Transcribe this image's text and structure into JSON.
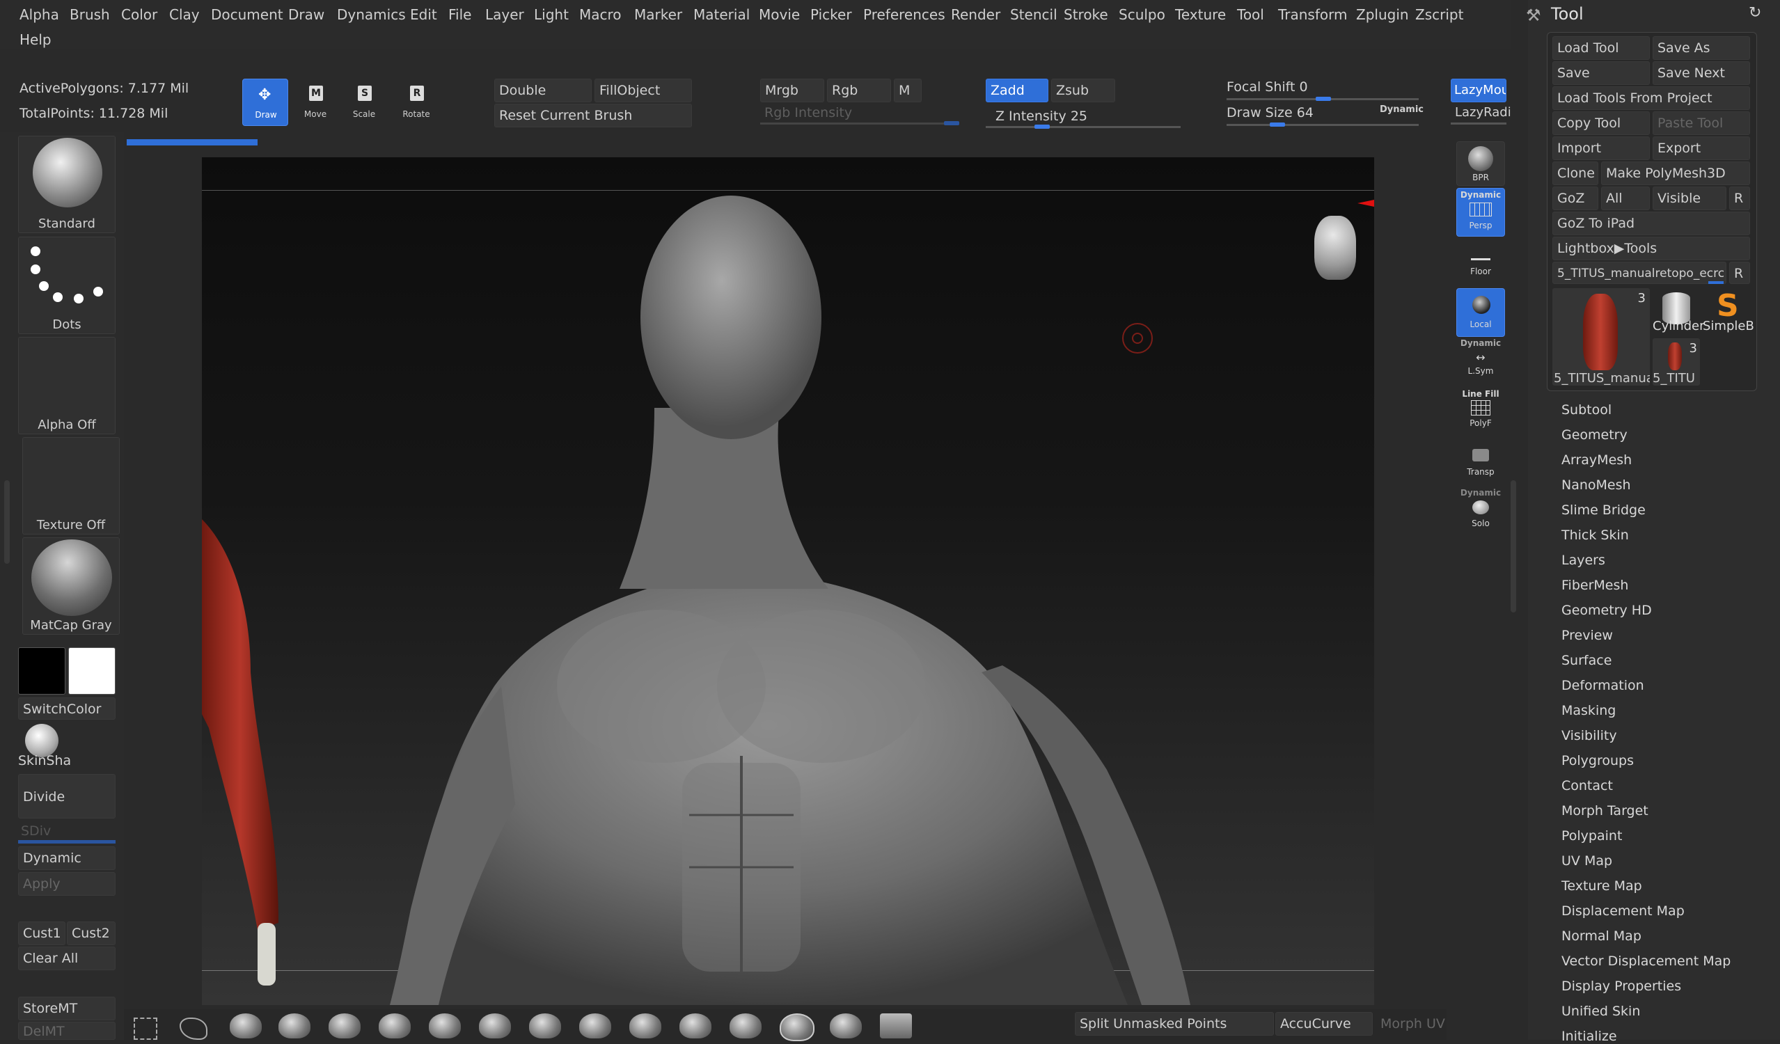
{
  "menu": {
    "row1": [
      "Alpha",
      "Brush",
      "Color",
      "Clay",
      "Document",
      "Draw",
      "Dynamics",
      "Edit",
      "File",
      "Layer",
      "Light",
      "Macro",
      "Marker",
      "Material",
      "Movie",
      "Picker",
      "Preferences",
      "Render",
      "Stencil",
      "Stroke",
      "Sculpo",
      "Texture",
      "Tool",
      "Transform",
      "Zplugin",
      "Zscript"
    ],
    "row2": [
      "Help"
    ]
  },
  "stats": {
    "active_polygons": "ActivePolygons: 7.177 Mil",
    "total_points": "TotalPoints: 11.728 Mil"
  },
  "transform": {
    "draw": "Draw",
    "move": "Move",
    "scale": "Scale",
    "rotate": "Rotate",
    "draw_key": "",
    "move_key": "M",
    "scale_key": "S",
    "rotate_key": "R"
  },
  "draw_opts": {
    "double": "Double",
    "fill_object": "FillObject",
    "reset_brush": "Reset Current Brush"
  },
  "color_opts": {
    "mrgb": "Mrgb",
    "rgb": "Rgb",
    "m": "M",
    "rgb_intensity": "Rgb Intensity"
  },
  "depth_opts": {
    "zadd": "Zadd",
    "zsub": "Zsub",
    "z_intensity_label": "Z Intensity",
    "z_intensity_value": "25",
    "z_intensity_fraction": 0.25
  },
  "brush_opts": {
    "focal_shift_label": "Focal Shift",
    "focal_shift_value": "0",
    "draw_size_label": "Draw Size",
    "draw_size_value": "64",
    "dynamic": "Dynamic"
  },
  "lazy": {
    "lazy_mouse": "LazyMou",
    "lazy_radius": "LazyRadi"
  },
  "left_shelf": {
    "brush": "Standard",
    "stroke": "Dots",
    "alpha": "Alpha Off",
    "texture": "Texture Off",
    "material": "MatCap Gray",
    "switch_color": "SwitchColor",
    "skin_shade": "SkinSha",
    "divide": "Divide",
    "sdiv": "SDiv",
    "dynamic": "Dynamic",
    "apply": "Apply",
    "cust1": "Cust1",
    "cust2": "Cust2",
    "clear_all": "Clear All",
    "store_mt": "StoreMT",
    "del_mt": "DelMT",
    "primary_color": "#000000",
    "secondary_color": "#ffffff"
  },
  "right_shelf": {
    "bpr": "BPR",
    "dynamic1": "Dynamic",
    "persp": "Persp",
    "floor": "Floor",
    "local": "Local",
    "dynamic2": "Dynamic",
    "lsym": "L.Sym",
    "line_fill": "Line Fill",
    "polyf": "PolyF",
    "transp": "Transp",
    "dynamic3": "Dynamic",
    "solo": "Solo"
  },
  "tool_panel": {
    "title": "Tool",
    "buttons": {
      "load_tool": "Load Tool",
      "save_as": "Save As",
      "save": "Save",
      "save_next": "Save Next",
      "load_from_project": "Load Tools From Project",
      "copy_tool": "Copy Tool",
      "paste_tool": "Paste Tool",
      "import": "Import",
      "export": "Export",
      "clone": "Clone",
      "make_polymesh": "Make PolyMesh3D",
      "goz": "GoZ",
      "all": "All",
      "visible": "Visible",
      "r": "R",
      "goz_ipad": "GoZ To iPad",
      "lightbox_tools": "Lightbox▶Tools",
      "current_tool": "5_TITUS_manualretopo_ecrc",
      "r2": "R"
    },
    "thumbs": {
      "main_label": "5_TITUS_manua",
      "main_count": "3",
      "cylinder": "Cylinder",
      "simpleb": "SimpleB",
      "small_label": "5_TITU",
      "small_count": "3"
    },
    "sections": [
      "Subtool",
      "Geometry",
      "ArrayMesh",
      "NanoMesh",
      "Slime Bridge",
      "Thick Skin",
      "Layers",
      "FiberMesh",
      "Geometry HD",
      "Preview",
      "Surface",
      "Deformation",
      "Masking",
      "Visibility",
      "Polygroups",
      "Contact",
      "Morph Target",
      "Polypaint",
      "UV Map",
      "Texture Map",
      "Displacement Map",
      "Normal Map",
      "Vector Displacement Map",
      "Display Properties",
      "Unified Skin",
      "Initialize"
    ]
  },
  "bottom": {
    "split_unmasked": "Split Unmasked Points",
    "accucurve": "AccuCurve",
    "morph_uv": "Morph UV"
  },
  "colors": {
    "accent": "#2f6fd8",
    "muscle_red": "#a8301f"
  }
}
